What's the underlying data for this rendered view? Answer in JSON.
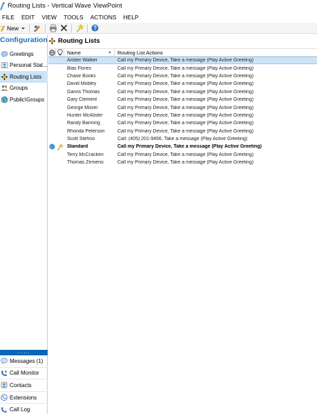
{
  "window": {
    "title": "Routing Lists - Vertical Wave ViewPoint"
  },
  "menu": [
    "FILE",
    "EDIT",
    "VIEW",
    "TOOLS",
    "ACTIONS",
    "HELP"
  ],
  "toolbar": {
    "new_label": "New"
  },
  "left": {
    "title": "Configuration",
    "items": [
      {
        "label": "Greetings",
        "icon": "greetings-icon"
      },
      {
        "label": "Personal Stat...",
        "icon": "personal-status-icon"
      },
      {
        "label": "Routing Lists",
        "icon": "routing-lists-icon",
        "selected": true
      },
      {
        "label": "Groups",
        "icon": "groups-icon"
      },
      {
        "label": "Public\\Groups",
        "icon": "public-groups-icon"
      }
    ],
    "grip": "......",
    "bottom": [
      {
        "label": "Messages (1)",
        "icon": "messages-icon"
      },
      {
        "label": "Call Monitor",
        "icon": "call-monitor-icon"
      },
      {
        "label": "Contacts",
        "icon": "contacts-icon"
      },
      {
        "label": "Extensions",
        "icon": "extensions-icon"
      },
      {
        "label": "Call Log",
        "icon": "call-log-icon"
      }
    ]
  },
  "main": {
    "title": "Routing Lists",
    "columns": {
      "name": "Name",
      "actions": "Routing List Actions"
    },
    "rows": [
      {
        "name": "Amber Walker",
        "actions": "Call my Primary Device, Take a message (Play Active Greeting)",
        "selected": true
      },
      {
        "name": "Blas Flores",
        "actions": "Call my Primary Device, Take a message (Play Active Greeting)"
      },
      {
        "name": "Chase Books",
        "actions": "Call my Primary Device, Take a message (Play Active Greeting)"
      },
      {
        "name": "David Mobley",
        "actions": "Call my Primary Device, Take a message (Play Active Greeting)"
      },
      {
        "name": "Garvis Thomas",
        "actions": "Call my Primary Device, Take a message (Play Active Greeting)"
      },
      {
        "name": "Gary Clement",
        "actions": "Call my Primary Device, Take a message (Play Active Greeting)"
      },
      {
        "name": "George Moser",
        "actions": "Call my Primary Device, Take a message (Play Active Greeting)"
      },
      {
        "name": "Hunter McAlister",
        "actions": "Call my Primary Device, Take a message (Play Active Greeting)"
      },
      {
        "name": "Randy Banning",
        "actions": "Call my Primary Device, Take a message (Play Active Greeting)"
      },
      {
        "name": "Rhonda Peterson",
        "actions": "Call my Primary Device, Take a message (Play Active Greeting)"
      },
      {
        "name": "Scott Stehno",
        "actions": "Call: (405) 201-9456, Take a message (Play Active Greeting)"
      },
      {
        "name": "Standard",
        "actions": "Call my Primary Device, Take a message (Play Active Greeting)",
        "bold": true,
        "global": true,
        "active": true
      },
      {
        "name": "Terry McCracken",
        "actions": "Call my Primary Device, Take a message (Play Active Greeting)"
      },
      {
        "name": "Thomas Zemeno",
        "actions": "Call my Primary Device, Take a message (Play Active Greeting)"
      }
    ]
  }
}
